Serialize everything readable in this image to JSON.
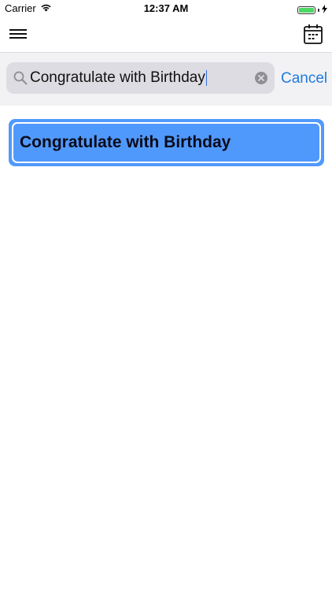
{
  "status_bar": {
    "carrier": "Carrier",
    "time": "12:37 AM"
  },
  "nav": {
    "menu_icon": "hamburger-menu-icon",
    "calendar_icon": "calendar-icon"
  },
  "search": {
    "value": "Congratulate with Birthday",
    "cancel_label": "Cancel"
  },
  "results": [
    {
      "title": "Congratulate with Birthday"
    }
  ],
  "colors": {
    "accent": "#1f7ae0",
    "result_card": "#5099fc",
    "battery": "#4cd964"
  }
}
